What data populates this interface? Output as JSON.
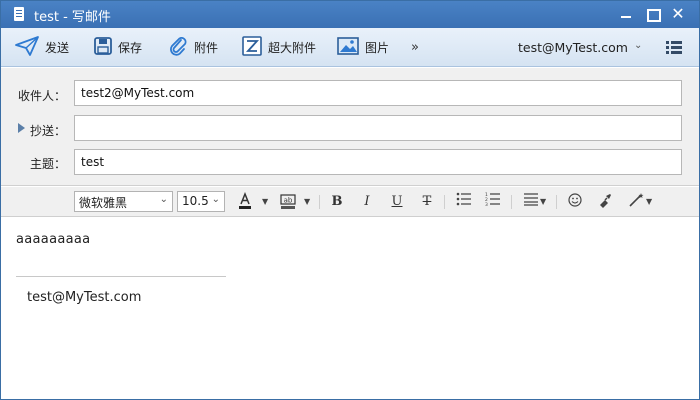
{
  "window": {
    "title": "test - 写邮件",
    "minimize_icon": "minimize-icon",
    "maximize_icon": "maximize-icon",
    "close_icon": "close-icon",
    "close_glyph": "✕"
  },
  "toolbar": {
    "send_label": "发送",
    "save_label": "保存",
    "attach_label": "附件",
    "big_attach_label": "超大附件",
    "image_label": "图片",
    "more_label": "»",
    "account": "test@MyTest.com",
    "account_chevron": "⌄"
  },
  "headers": {
    "to_label": "收件人：",
    "to_value": "test2@MyTest.com",
    "cc_label": "抄送：",
    "cc_value": "",
    "subject_label": "主题：",
    "subject_value": "test"
  },
  "format": {
    "font_family": "微软雅黑",
    "font_size": "10.5",
    "bold": "B",
    "italic": "I",
    "underline": "U",
    "strike": "T"
  },
  "body": {
    "text": "aaaaaaaaa",
    "signature": "test@MyTest.com"
  },
  "colors": {
    "titlebar": "#3a70b4",
    "accent": "#2e7ad1"
  }
}
